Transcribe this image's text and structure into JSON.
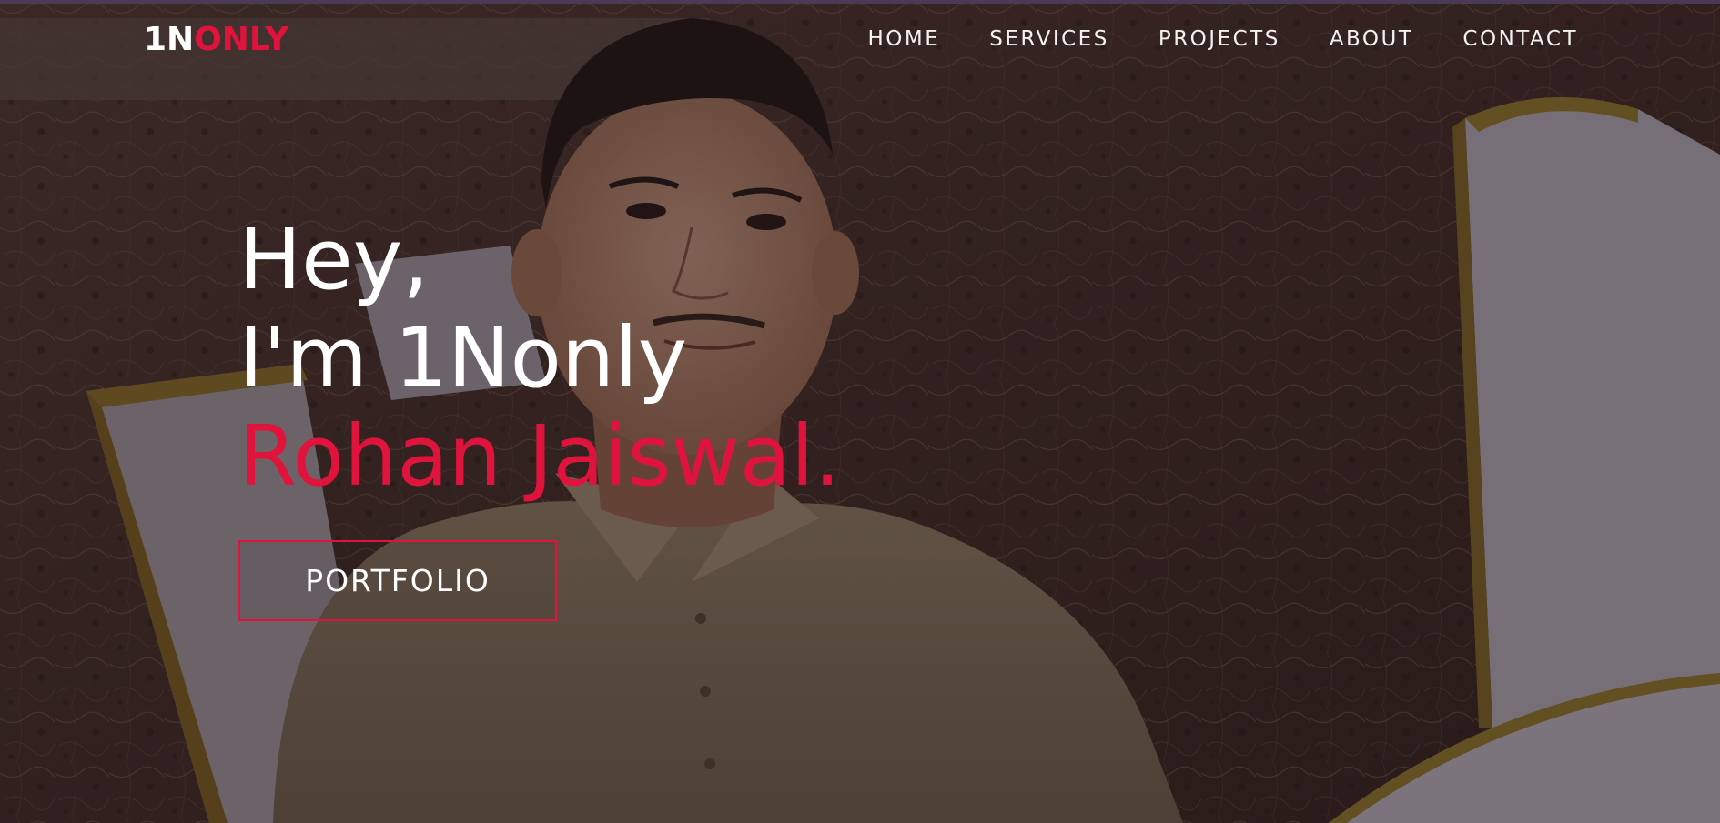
{
  "brand": {
    "logo_white": "1N",
    "logo_red": "ONLY"
  },
  "nav": {
    "items": [
      {
        "label": "HOME"
      },
      {
        "label": "SERVICES"
      },
      {
        "label": "PROJECTS"
      },
      {
        "label": "ABOUT"
      },
      {
        "label": "CONTACT"
      }
    ]
  },
  "hero": {
    "line1": "Hey,",
    "line2": "I'm 1Nonly",
    "line3": "Rohan Jaiswal.",
    "button_label": "PORTFOLIO"
  },
  "colors": {
    "accent": "#e0133d",
    "text": "#ffffff",
    "nav_text": "#f2f2f2"
  },
  "icons": {
    "background": "portrait-photo"
  }
}
